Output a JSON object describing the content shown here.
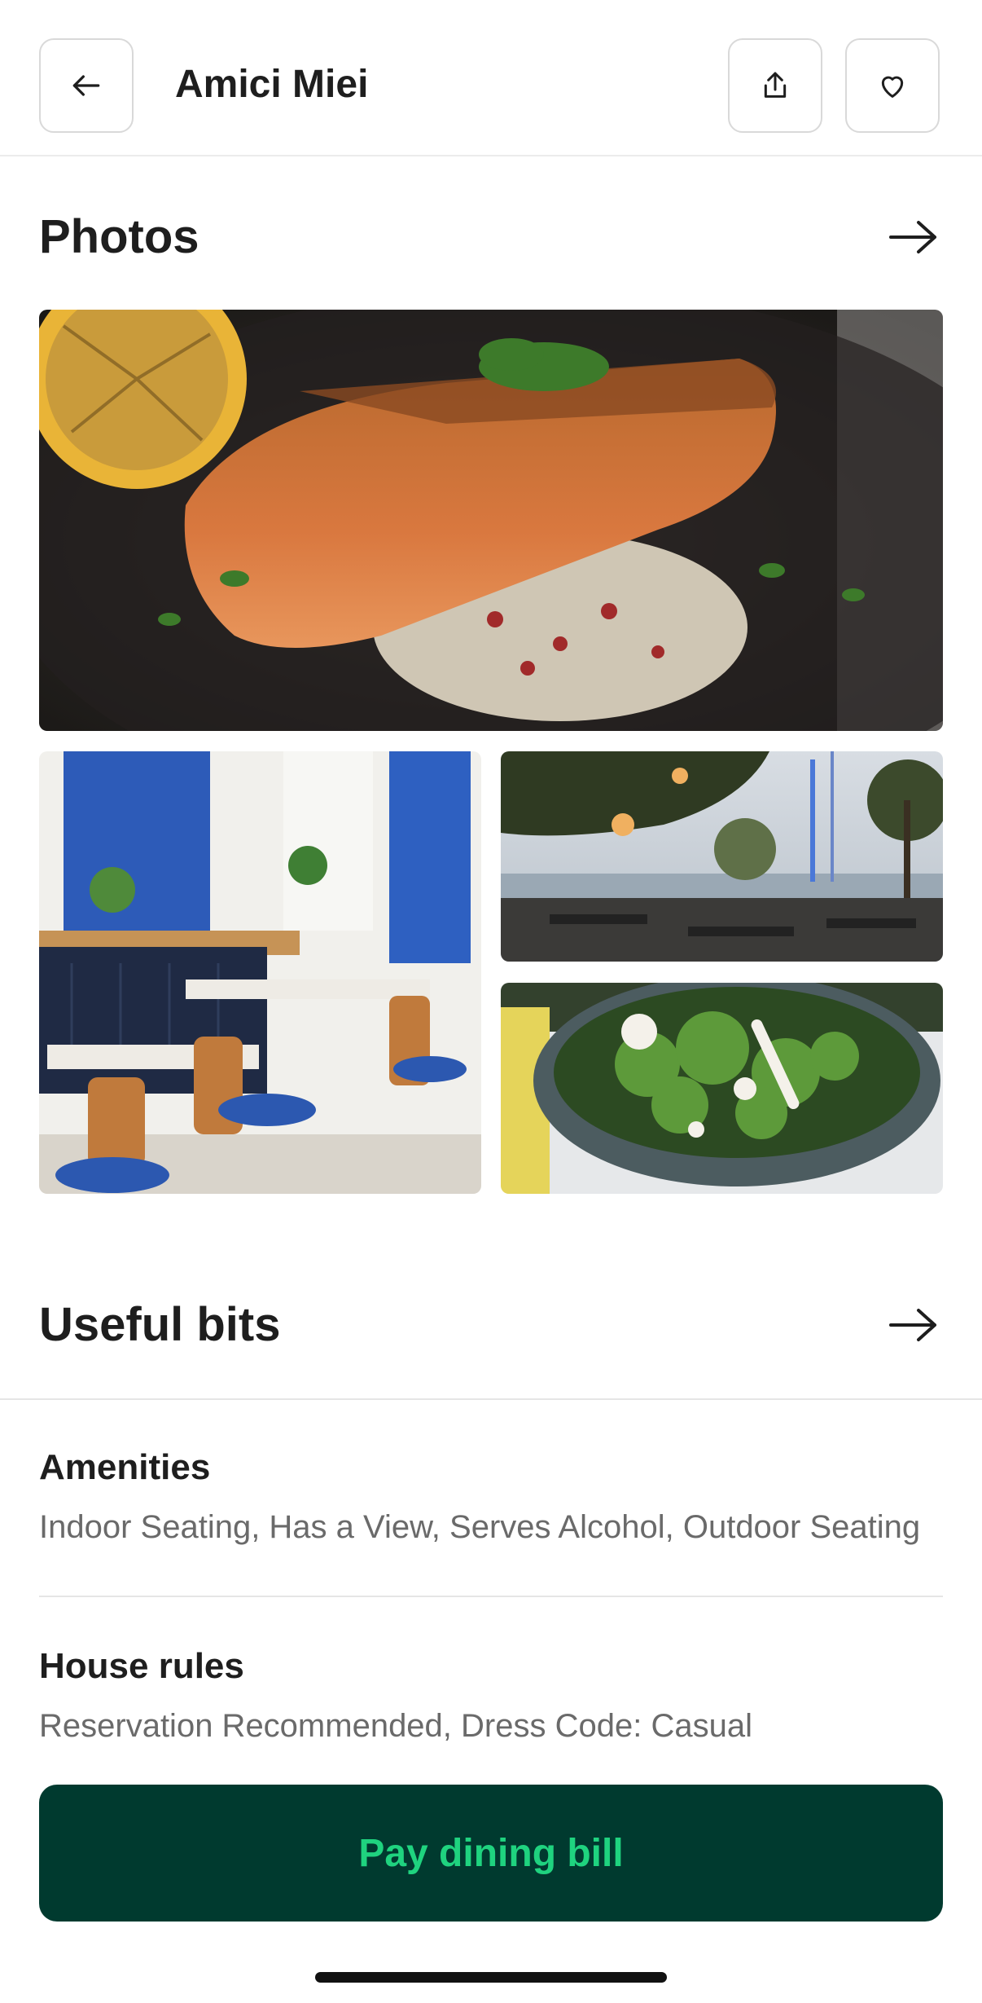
{
  "header": {
    "title": "Amici Miei",
    "back_icon": "arrow-left-icon",
    "share_icon": "share-icon",
    "favorite_icon": "heart-icon"
  },
  "photos": {
    "title": "Photos",
    "arrow_icon": "arrow-right-icon",
    "items": [
      {
        "subject": "salmon-on-quinoa"
      },
      {
        "subject": "indoor-dining-room"
      },
      {
        "subject": "outdoor-terrace-marina"
      },
      {
        "subject": "kale-salad-bowl"
      }
    ]
  },
  "useful_bits": {
    "title": "Useful bits",
    "arrow_icon": "arrow-right-icon",
    "items": [
      {
        "title": "Amenities",
        "text": "Indoor Seating, Has a View, Serves Alcohol, Outdoor Seating"
      },
      {
        "title": "House rules",
        "text": "Reservation Recommended, Dress Code: Casual"
      }
    ]
  },
  "cta": {
    "label": "Pay dining bill"
  },
  "colors": {
    "cta_background": "#003a2f",
    "cta_text": "#1fd37f",
    "text_primary": "#1e1e1e",
    "text_secondary": "#6a6a6a"
  }
}
